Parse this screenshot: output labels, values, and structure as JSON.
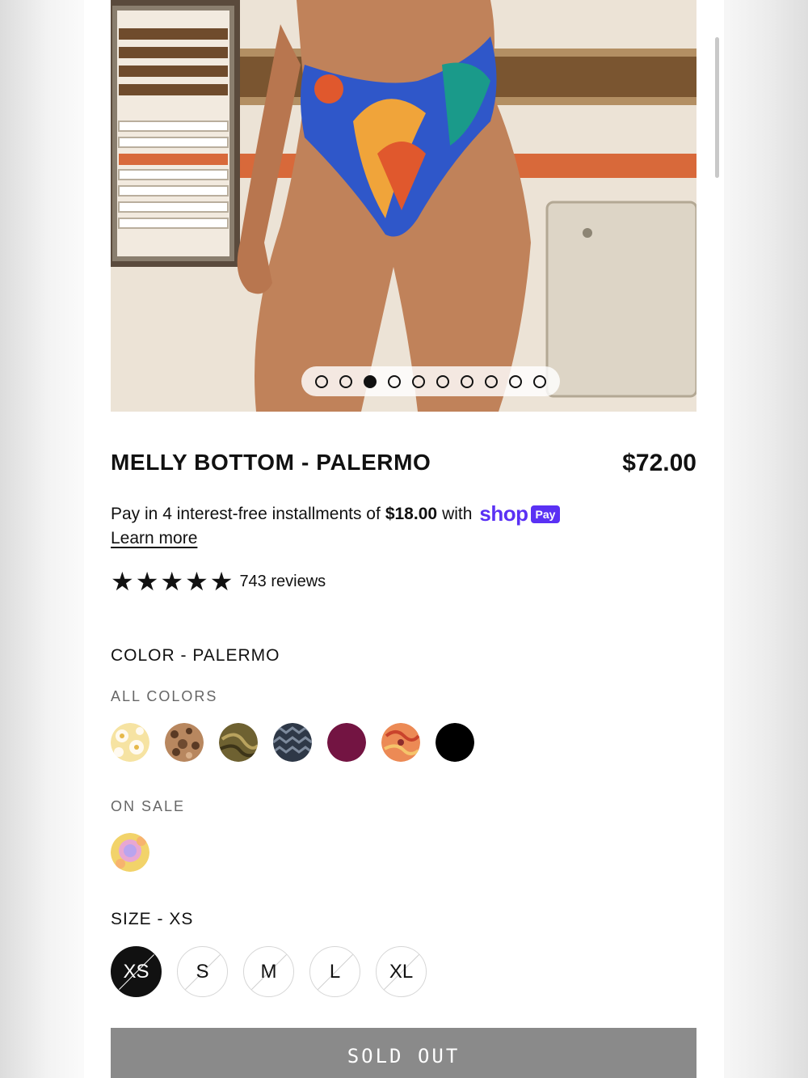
{
  "product": {
    "title": "MELLY BOTTOM - PALERMO",
    "price": "$72.00"
  },
  "gallery": {
    "image": "bikini-bottom-photo",
    "dots_total": 10,
    "dots_active_index": 2
  },
  "installments": {
    "prefix": "Pay in 4 interest-free installments of",
    "amount": "$18.00",
    "suffix": "with",
    "shop_label": "shop",
    "pay_label": "Pay",
    "learn_more": "Learn more"
  },
  "rating": {
    "stars": 5,
    "reviews_text": "743 reviews"
  },
  "color": {
    "label": "COLOR - PALERMO",
    "all_colors_label": "ALL COLORS",
    "swatches": [
      {
        "name": "yellow-floral",
        "color": "#f3d98a"
      },
      {
        "name": "brown-leopard",
        "color": "#9a6a4c"
      },
      {
        "name": "olive-swirl",
        "color": "#6e6131"
      },
      {
        "name": "navy-check",
        "color": "#3b4656"
      },
      {
        "name": "burgundy",
        "color": "#731442"
      },
      {
        "name": "orange-print",
        "color": "#e87c4e"
      },
      {
        "name": "black",
        "color": "#000000"
      }
    ],
    "on_sale_label": "ON SALE",
    "sale_swatches": [
      {
        "name": "pastel-tie-dye",
        "color": "#e8a7d2"
      }
    ]
  },
  "size": {
    "label": "SIZE - XS",
    "options": [
      "XS",
      "S",
      "M",
      "L",
      "XL"
    ],
    "selected": "XS"
  },
  "cta": {
    "label": "SOLD OUT"
  }
}
